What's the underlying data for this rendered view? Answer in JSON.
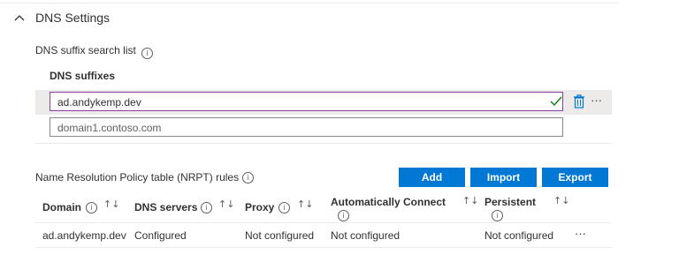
{
  "section": {
    "title": "DNS Settings",
    "chevron_icon": "chevron-up-icon"
  },
  "dns_suffix": {
    "label": "DNS suffix search list",
    "info_icon": "info-icon",
    "column_header": "DNS suffixes",
    "items": [
      {
        "value": "ad.andykemp.dev",
        "selected": true
      },
      {
        "value": "domain1.contoso.com",
        "selected": false
      }
    ],
    "row_actions": {
      "check_icon": "checkmark-icon",
      "delete_icon": "trash-icon",
      "more_icon": "more-icon",
      "more_text": "···"
    }
  },
  "nrpt": {
    "label": "Name Resolution Policy table (NRPT) rules",
    "buttons": {
      "add": "Add",
      "import": "Import",
      "export": "Export"
    },
    "headers": {
      "domain": "Domain",
      "dns_servers": "DNS servers",
      "proxy": "Proxy",
      "auto_connect": "Automatically Connect",
      "persistent": "Persistent"
    },
    "sort_glyph": "↑↓",
    "info_glyph": "i",
    "rows": [
      {
        "domain": "ad.andykemp.dev",
        "dns_servers": "Configured",
        "proxy": "Not configured",
        "auto_connect": "Not configured",
        "persistent": "Not configured",
        "more_text": "···"
      }
    ]
  },
  "colors": {
    "accent": "#0078d4",
    "focus_border": "#8a3f9f",
    "valid_check": "#107c10",
    "selected_row": "#edebe9"
  }
}
